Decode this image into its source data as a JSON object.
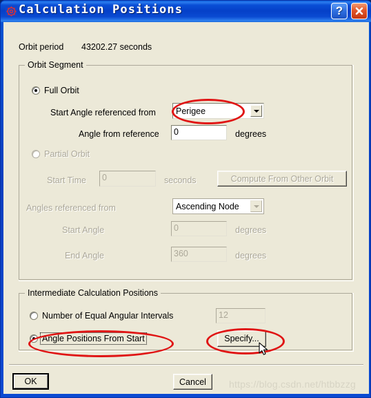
{
  "window": {
    "title": "Calculation Positions",
    "icon": "app-gear-icon",
    "help_label": "?",
    "close_label": "X",
    "frame_color": "#0a4ad2",
    "client_color": "#ece9d8"
  },
  "header": {
    "orbit_period_label": "Orbit period",
    "orbit_period_value": "43202.27 seconds"
  },
  "orbit_segment": {
    "title": "Orbit Segment",
    "full_orbit": {
      "label": "Full Orbit",
      "selected": true,
      "start_angle_ref_label": "Start Angle referenced from",
      "start_angle_ref_value": "Perigee",
      "angle_from_ref_label": "Angle from reference",
      "angle_from_ref_value": "0",
      "angle_from_ref_units": "degrees"
    },
    "partial_orbit": {
      "label": "Partial Orbit",
      "selected": false,
      "start_time_label": "Start Time",
      "start_time_value": "0",
      "start_time_units": "seconds",
      "compute_button": "Compute From Other Orbit",
      "angles_ref_label": "Angles referenced from",
      "angles_ref_value": "Ascending Node",
      "start_angle_label": "Start Angle",
      "start_angle_value": "0",
      "start_angle_units": "degrees",
      "end_angle_label": "End Angle",
      "end_angle_value": "360",
      "end_angle_units": "degrees"
    }
  },
  "intermediate": {
    "title": "Intermediate Calculation Positions",
    "intervals": {
      "label": "Number of Equal Angular Intervals",
      "selected": false,
      "value": "12"
    },
    "angle_positions": {
      "label": "Angle Positions From Start",
      "selected": true,
      "specify_button": "Specify..."
    }
  },
  "footer": {
    "ok_label": "OK",
    "cancel_label": "Cancel"
  },
  "annotations": {
    "accent_color": "#e01414",
    "marked": [
      "start-angle-referenced-from-combo",
      "angle-positions-from-start-radio",
      "specify-button"
    ]
  },
  "watermark": {
    "text": "https://blog.csdn.net/htbbzzg"
  }
}
